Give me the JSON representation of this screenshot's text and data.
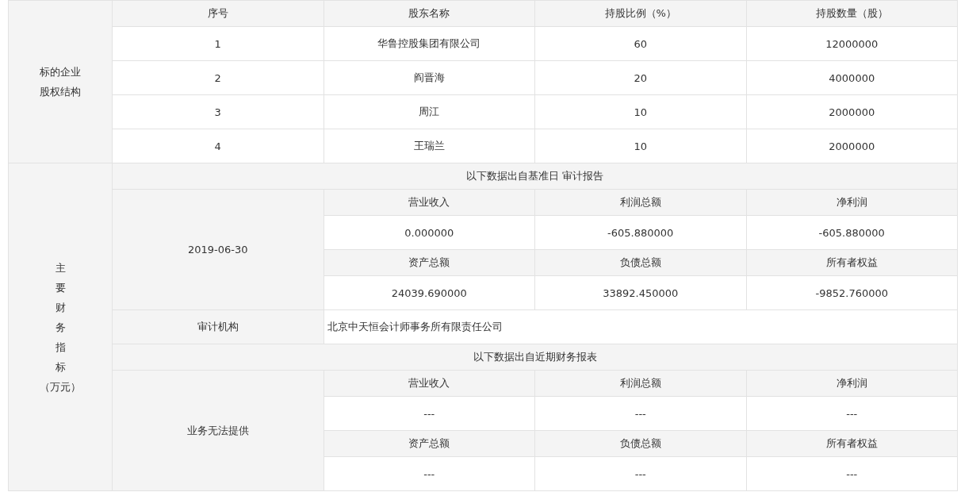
{
  "equity": {
    "label": "标的企业股权结构",
    "columns": [
      "序号",
      "股东名称",
      "持股比例（%）",
      "持股数量（股）"
    ],
    "rows": [
      [
        "1",
        "华鲁控股集团有限公司",
        "60",
        "12000000"
      ],
      [
        "2",
        "阎晋海",
        "20",
        "4000000"
      ],
      [
        "3",
        "周江",
        "10",
        "2000000"
      ],
      [
        "4",
        "王瑞兰",
        "10",
        "2000000"
      ]
    ]
  },
  "financials": {
    "label": "主要财务指标",
    "unit": "（万元）",
    "blocks": [
      {
        "kind": "period",
        "title": "以下数据出自基准日 审计报告",
        "period": "2019-06-30",
        "groups": [
          {
            "headers": [
              "营业收入",
              "利润总额",
              "净利润"
            ],
            "values": [
              "0.000000",
              "-605.880000",
              "-605.880000"
            ]
          },
          {
            "headers": [
              "资产总额",
              "负债总额",
              "所有者权益"
            ],
            "values": [
              "24039.690000",
              "33892.450000",
              "-9852.760000"
            ]
          }
        ]
      },
      {
        "kind": "auditor",
        "label": "审计机构",
        "value": "北京中天恒会计师事务所有限责任公司"
      },
      {
        "kind": "period",
        "title": "以下数据出自近期财务报表",
        "period": "业务无法提供",
        "groups": [
          {
            "headers": [
              "营业收入",
              "利润总额",
              "净利润"
            ],
            "values": [
              "---",
              "---",
              "---"
            ]
          },
          {
            "headers": [
              "资产总额",
              "负债总额",
              "所有者权益"
            ],
            "values": [
              "---",
              "---",
              "---"
            ]
          }
        ]
      }
    ]
  }
}
